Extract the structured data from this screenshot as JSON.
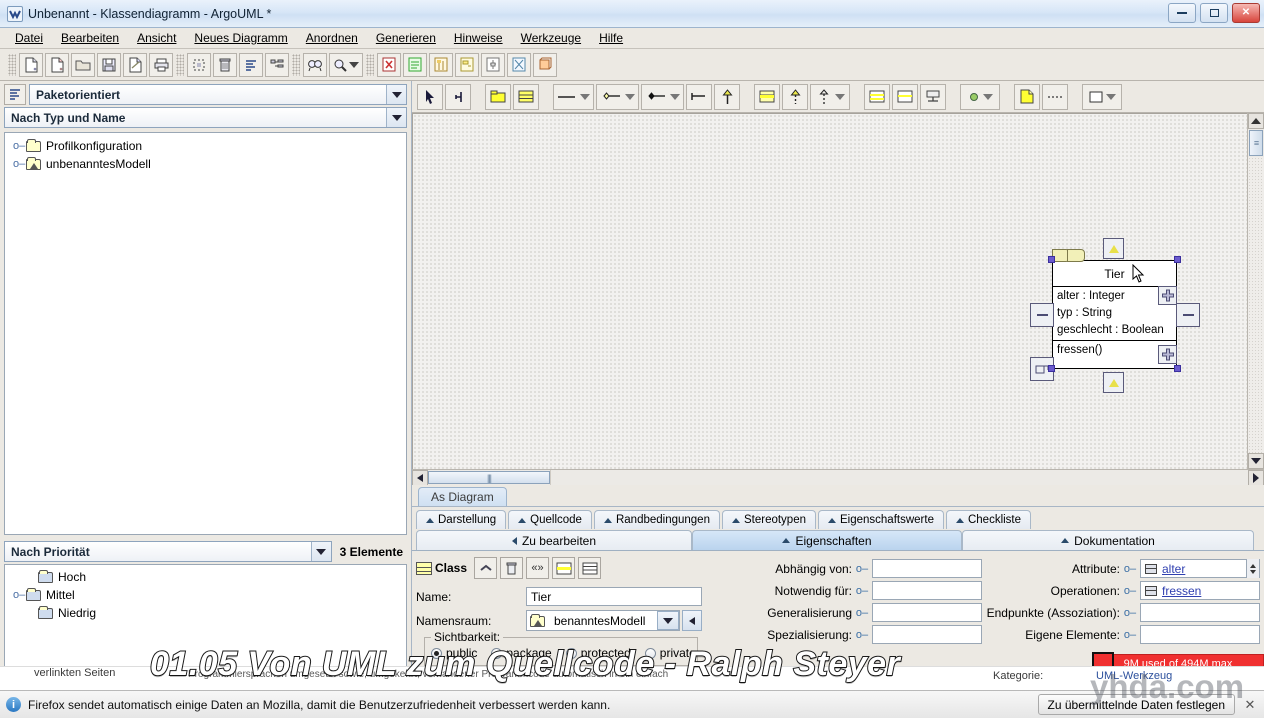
{
  "window": {
    "title": "Unbenannt - Klassendiagramm - ArgoUML *",
    "app_icon": "argouml-icon",
    "minimize_label": "—",
    "maximize_label": "▫",
    "close_label": "✕"
  },
  "menu": {
    "items": [
      {
        "label": "Datei"
      },
      {
        "label": "Bearbeiten"
      },
      {
        "label": "Ansicht"
      },
      {
        "label": "Neues Diagramm"
      },
      {
        "label": "Anordnen"
      },
      {
        "label": "Generieren"
      },
      {
        "label": "Hinweise"
      },
      {
        "label": "Werkzeuge"
      },
      {
        "label": "Hilfe"
      }
    ]
  },
  "main_toolbar": {
    "buttons": [
      {
        "name": "new-file-icon"
      },
      {
        "name": "open-project-icon"
      },
      {
        "name": "open-folder-icon"
      },
      {
        "name": "save-icon"
      },
      {
        "name": "save-as-icon"
      },
      {
        "name": "print-icon"
      },
      {
        "name": "select-all-icon"
      },
      {
        "name": "delete-icon"
      },
      {
        "name": "align-icon"
      },
      {
        "name": "layout-icon"
      },
      {
        "name": "find-icon"
      },
      {
        "name": "zoom-icon"
      },
      {
        "name": "new-usecase-diagram-icon"
      },
      {
        "name": "new-class-diagram-icon"
      },
      {
        "name": "new-sequence-diagram-icon"
      },
      {
        "name": "new-state-diagram-icon"
      },
      {
        "name": "new-activity-diagram-icon"
      },
      {
        "name": "new-collaboration-diagram-icon"
      },
      {
        "name": "new-deployment-diagram-icon"
      }
    ]
  },
  "explorer": {
    "perspective_icon": "explorer-perspective-icon",
    "perspective": "Paketorientiert",
    "ordering": "Nach Typ und Name",
    "tree": [
      {
        "label": "Profilkonfiguration",
        "icon": "folder-icon"
      },
      {
        "label": "unbenanntesModell",
        "icon": "model-folder-icon"
      }
    ]
  },
  "todo": {
    "ordering": "Nach Priorität",
    "count": "3 Elemente",
    "items": [
      {
        "label": "Hoch"
      },
      {
        "label": "Mittel"
      },
      {
        "label": "Niedrig"
      }
    ]
  },
  "diagram_toolbar": {
    "buttons": [
      {
        "name": "select-pointer-icon"
      },
      {
        "name": "broom-icon"
      },
      {
        "name": "package-tool-icon"
      },
      {
        "name": "class-tool-icon"
      },
      {
        "name": "association-tool-icon"
      },
      {
        "name": "aggregation-tool-icon"
      },
      {
        "name": "composition-tool-icon"
      },
      {
        "name": "dependency-tool-icon"
      },
      {
        "name": "generalization-tool-icon"
      },
      {
        "name": "interface-tool-icon"
      },
      {
        "name": "realization-tool-icon"
      },
      {
        "name": "abstraction-tool-icon"
      },
      {
        "name": "enumeration-tool-icon"
      },
      {
        "name": "datatype-tool-icon"
      },
      {
        "name": "stereotype-tool-icon"
      },
      {
        "name": "signal-tool-icon"
      },
      {
        "name": "comment-tool-icon"
      },
      {
        "name": "comment-link-tool-icon"
      },
      {
        "name": "rectangle-tool-icon"
      }
    ]
  },
  "diagram": {
    "tab_label": "As Diagram",
    "uml_class": {
      "name": "Tier",
      "attributes": [
        "alter : Integer",
        "typ : String",
        "geschlecht : Boolean"
      ],
      "operations": [
        "fressen()"
      ]
    }
  },
  "details": {
    "tabs_top": [
      {
        "label": "Darstellung"
      },
      {
        "label": "Quellcode"
      },
      {
        "label": "Randbedingungen"
      },
      {
        "label": "Stereotypen"
      },
      {
        "label": "Eigenschaftswerte"
      },
      {
        "label": "Checkliste"
      }
    ],
    "tabs_bottom": [
      {
        "label": "Zu bearbeiten",
        "selected": false
      },
      {
        "label": "Eigenschaften",
        "selected": true
      },
      {
        "label": "Dokumentation",
        "selected": false
      }
    ],
    "properties": {
      "type_label": "Class",
      "toolbar_buttons": [
        {
          "name": "go-up-icon"
        },
        {
          "name": "delete-element-icon"
        },
        {
          "name": "stereotype-icon"
        },
        {
          "name": "new-attribute-icon"
        },
        {
          "name": "new-operation-icon"
        }
      ],
      "name_label": "Name:",
      "name_value": "Tier",
      "namespace_label": "Namensraum:",
      "namespace_value": "benanntesModell",
      "visibility_label": "Sichtbarkeit:",
      "visibility_options": [
        {
          "label": "public",
          "selected": true
        },
        {
          "label": "package",
          "selected": false
        },
        {
          "label": "protected",
          "selected": false
        },
        {
          "label": "private",
          "selected": false
        }
      ],
      "mid_fields": [
        {
          "label": "Abhängig von:",
          "value": ""
        },
        {
          "label": "Notwendig für:",
          "value": ""
        },
        {
          "label": "Generalisierung",
          "value": ""
        },
        {
          "label": "Spezialisierung:",
          "value": ""
        }
      ],
      "right_fields": [
        {
          "label": "Attribute:",
          "value": "alter",
          "has_spinner": true
        },
        {
          "label": "Operationen:",
          "value": "fressen",
          "has_spinner": false
        },
        {
          "label": "Endpunkte (Assoziation):",
          "value": "",
          "has_spinner": false
        },
        {
          "label": "Eigene Elemente:",
          "value": "",
          "has_spinner": false
        }
      ]
    }
  },
  "memory": {
    "text": "9M used of 494M max",
    "color": "#f03030"
  },
  "browser_strip": {
    "left_text": "verlinkten Seiten",
    "mid_text": "Programmiersprachen umgesetzt sowie, umgekehrt, vorhandener Programmcode automatisch in ein einfach",
    "category_label": "Kategorie:",
    "category_value": "UML-Werkzeug"
  },
  "firefox_bar": {
    "info_icon": "info-icon",
    "message": "Firefox sendet automatisch einige Daten an Mozilla, damit die Benutzerzufriedenheit verbessert werden kann.",
    "button_label": "Zu übermittelnde Daten festlegen",
    "close_label": "✕"
  },
  "video_overlay": {
    "title": "01.05 Von UML zum Quellcode - Ralph Steyer",
    "watermark": "yhda.com"
  }
}
